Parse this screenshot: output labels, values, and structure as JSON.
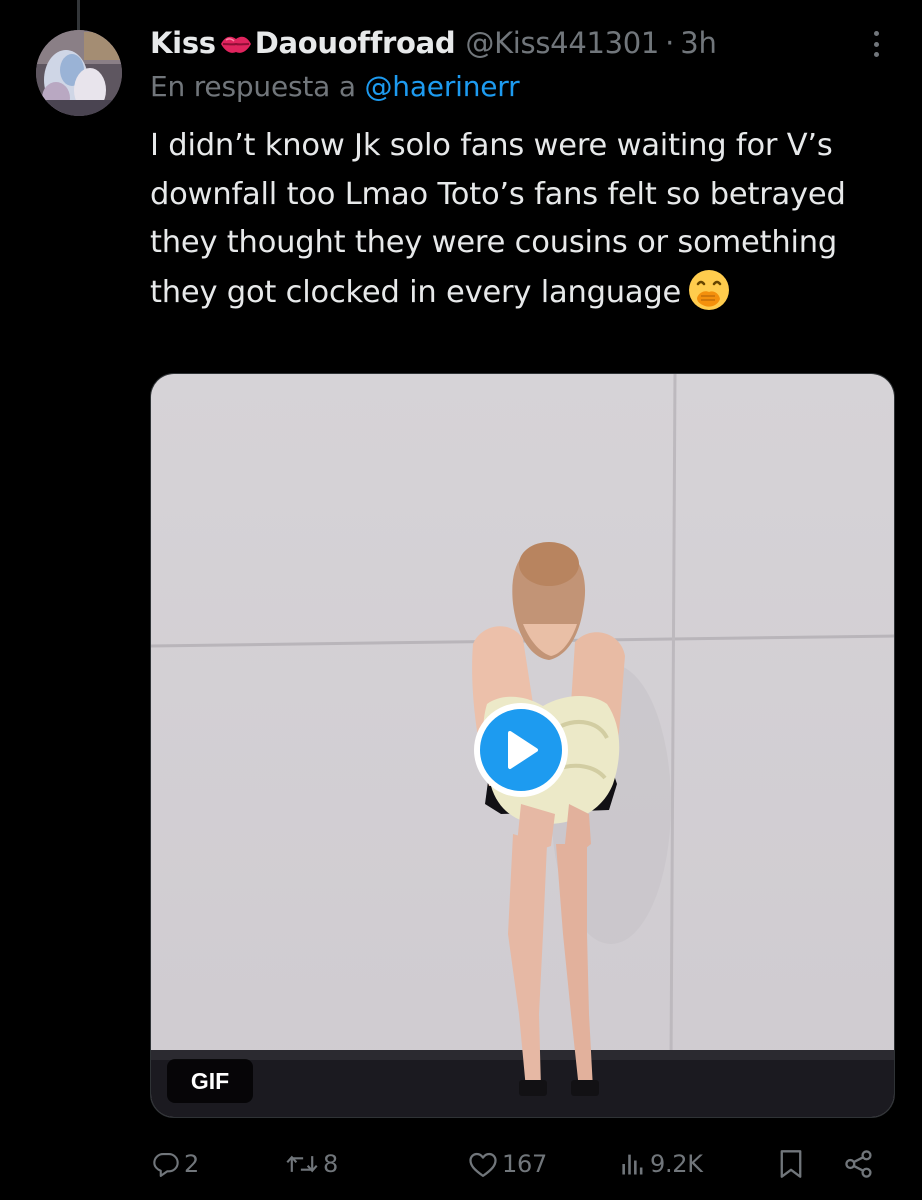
{
  "tweet": {
    "display_name_part1": "Kiss",
    "display_name_emoji": "kiss-lips-emoji",
    "display_name_part2": "Daouoffroad",
    "handle": "@Kiss441301",
    "separator": "·",
    "time": "3h",
    "reply_prefix": "En respuesta a",
    "reply_handle": "@haerinerr",
    "text": "I didn’t know Jk solo fans were waiting for V’s downfall too Lmao Toto’s fans felt so betrayed they thought they were cousins or something they got clocked in every language",
    "text_emoji": "face-with-hand-over-mouth-emoji"
  },
  "media": {
    "badge": "GIF",
    "play_icon": "play-icon"
  },
  "actions": {
    "replies": "2",
    "retweets": "8",
    "likes": "167",
    "views": "9.2K"
  },
  "colors": {
    "background": "#000000",
    "text": "#e7e9ea",
    "muted": "#71767b",
    "accent": "#1d9bf0"
  }
}
